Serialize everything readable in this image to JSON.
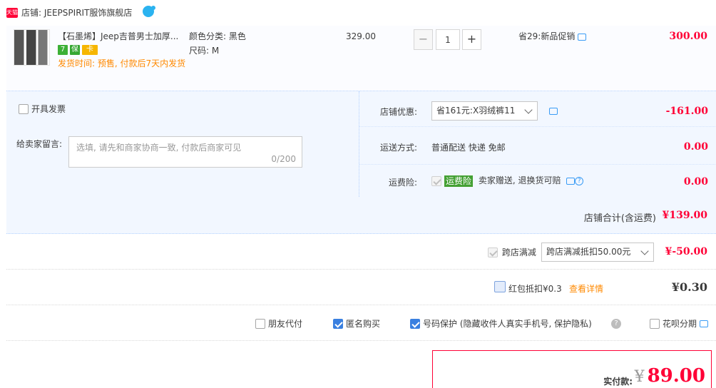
{
  "shop": {
    "badge": "天猫",
    "name": "店铺: JEEPSPIRIT服饰旗舰店"
  },
  "item": {
    "title": "【石墨烯】Jeep吉普男士加厚...",
    "badges": [
      "7",
      "保",
      "卡"
    ],
    "ship_time": "发货时间: 预售, 付款后7天内发货",
    "sku_color": "颜色分类: 黑色",
    "sku_size": "尺码: M",
    "price": "329.00",
    "qty_minus": "−",
    "qty_value": "1",
    "qty_plus": "+",
    "promo": "省29:新品促销",
    "subtotal": "300.00"
  },
  "ops": {
    "invoice_label": "开具发票",
    "message_label": "给卖家留言:",
    "message_placeholder": "选填, 请先和商家协商一致, 付款后商家可见",
    "message_count": "0/200",
    "store_discount_label": "店铺优惠:",
    "store_discount_value": "省161元:X羽绒裤11",
    "store_discount_amount": "-161.00",
    "shipping_label": "运送方式:",
    "shipping_value": "普通配送 快递 免邮",
    "shipping_amount": "0.00",
    "insurance_label": "运费险:",
    "insurance_tag": "运费险",
    "insurance_text": "卖家赠送, 退换货可赔",
    "insurance_amount": "0.00"
  },
  "store_total": {
    "label": "店铺合计(含运费)",
    "amount": "¥139.00"
  },
  "cross_store": {
    "label": "跨店满减",
    "dropdown": "跨店满减抵扣50.00元",
    "amount": "¥-50.00"
  },
  "red_packet": {
    "label": "红包抵扣¥0.3",
    "link": "查看详情",
    "amount": "¥0.30"
  },
  "options": {
    "friend_pay": "朋友代付",
    "anonymous": "匿名购买",
    "number_protect": "号码保护 (隐藏收件人真实手机号, 保护隐私)",
    "help": "?",
    "huabei": "花呗分期"
  },
  "payment": {
    "label": "实付款:",
    "currency": "¥",
    "amount": "89.00"
  },
  "colors": {
    "accent_red": "#ff0036",
    "panel_blue": "#f2f7ff",
    "link_orange": "#ff8900",
    "check_blue": "#3a80e0"
  }
}
